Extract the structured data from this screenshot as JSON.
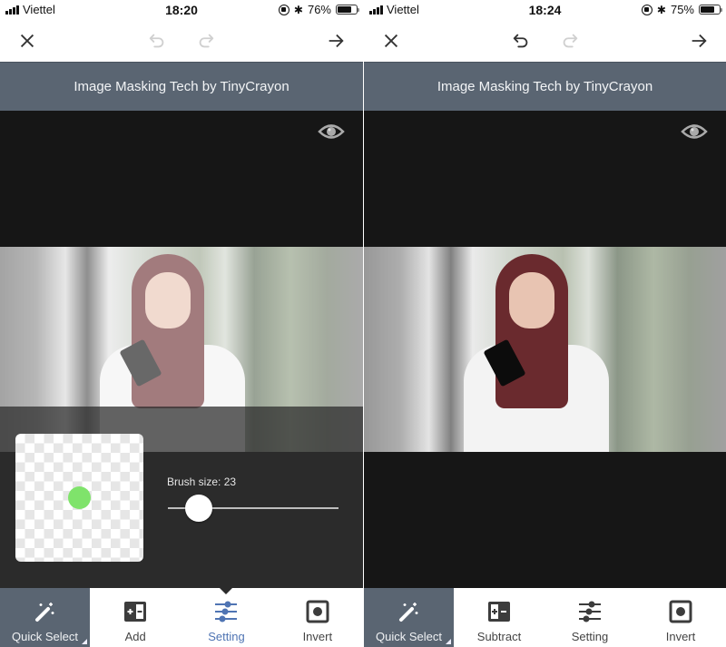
{
  "screens": [
    {
      "status": {
        "carrier": "Viettel",
        "time": "18:20",
        "battery": "76%",
        "battery_level": 0.76
      },
      "nav": {
        "undo_enabled": false,
        "redo_enabled": false
      },
      "title": "Image Masking Tech by TinyCrayon",
      "settings": {
        "brush_label": "Brush size: 23",
        "brush_size": 23,
        "slider_fraction": 0.18
      },
      "toolbar": [
        {
          "label": "Quick Select",
          "icon": "magic-wand-icon",
          "state": "mode"
        },
        {
          "label": "Add",
          "icon": "add-subtract-icon",
          "state": "normal"
        },
        {
          "label": "Setting",
          "icon": "sliders-icon",
          "state": "active"
        },
        {
          "label": "Invert",
          "icon": "invert-icon",
          "state": "normal"
        }
      ]
    },
    {
      "status": {
        "carrier": "Viettel",
        "time": "18:24",
        "battery": "75%",
        "battery_level": 0.75
      },
      "nav": {
        "undo_enabled": true,
        "redo_enabled": false
      },
      "title": "Image Masking Tech by TinyCrayon",
      "toolbar": [
        {
          "label": "Quick Select",
          "icon": "magic-wand-icon",
          "state": "mode"
        },
        {
          "label": "Subtract",
          "icon": "add-subtract-icon",
          "state": "normal"
        },
        {
          "label": "Setting",
          "icon": "sliders-icon",
          "state": "normal"
        },
        {
          "label": "Invert",
          "icon": "invert-icon",
          "state": "normal"
        }
      ]
    }
  ],
  "colors": {
    "title_bar": "#5a6572",
    "canvas": "#161616",
    "settings_panel": "#2b2b2b",
    "active_tool": "#4f74b3",
    "brush_dot": "#7fe36b",
    "disabled_icon": "#cccccc",
    "enabled_icon": "#333333"
  }
}
